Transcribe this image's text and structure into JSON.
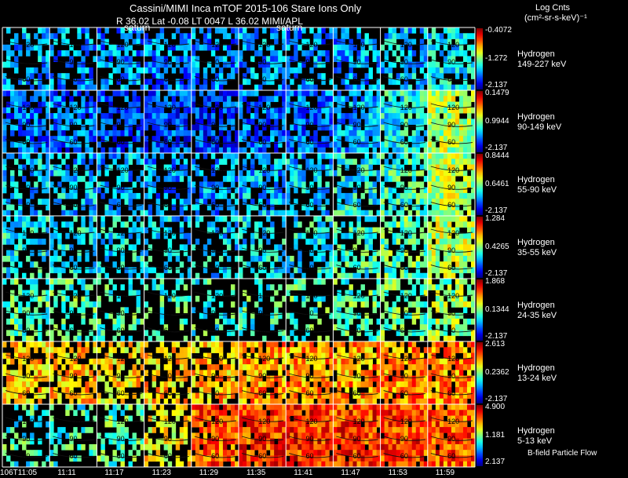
{
  "header": {
    "title": "Cassini/MIMI Inca mTOF  2015-106   Stare   Ions Only",
    "subtitle": "R         36.02  Lat -0.08  LT 0047  L          36.02  MIMI/APL",
    "units_line1": "Log Cnts",
    "units_line2": "(cm²-sr-s-keV)⁻¹",
    "footnote": "B-field Particle Flow",
    "panel_labels": [
      "saturn",
      "saturn"
    ]
  },
  "chart_data": {
    "type": "heatmap",
    "x_tick_labels": [
      "106T11:05",
      "11:11",
      "11:17",
      "11:23",
      "11:29",
      "11:35",
      "11:41",
      "11:47",
      "11:53",
      "11:59"
    ],
    "contour_labels": [
      "120",
      "90",
      "60"
    ],
    "rows": [
      {
        "species": "Hydrogen",
        "energy": "149-227 keV",
        "cb_max": "-0.4072",
        "cb_mid": "-1.272",
        "cb_min": "-2.137",
        "level": [
          0.3,
          0.28,
          0.27,
          0.25,
          0.26,
          0.28,
          0.27,
          0.28,
          0.32,
          0.36
        ],
        "fill": [
          0.5,
          0.5,
          0.55,
          0.6,
          0.6,
          0.55,
          0.55,
          0.55,
          0.6,
          0.65
        ]
      },
      {
        "species": "Hydrogen",
        "energy": "90-149 keV",
        "cb_max": "0.1479",
        "cb_mid": "0.9944",
        "cb_min": "-2.137",
        "level": [
          0.22,
          0.22,
          0.2,
          0.18,
          0.18,
          0.22,
          0.22,
          0.3,
          0.38,
          0.55
        ],
        "fill": [
          0.75,
          0.75,
          0.7,
          0.7,
          0.7,
          0.7,
          0.75,
          0.8,
          0.85,
          0.9
        ]
      },
      {
        "species": "Hydrogen",
        "energy": "55-90 keV",
        "cb_max": "0.8444",
        "cb_mid": "0.6461",
        "cb_min": "-2.137",
        "level": [
          0.32,
          0.32,
          0.3,
          0.28,
          0.28,
          0.3,
          0.32,
          0.38,
          0.42,
          0.55
        ],
        "fill": [
          0.55,
          0.55,
          0.55,
          0.5,
          0.55,
          0.55,
          0.6,
          0.65,
          0.7,
          0.9
        ]
      },
      {
        "species": "Hydrogen",
        "energy": "35-55 keV",
        "cb_max": "1.284",
        "cb_mid": "0.4265",
        "cb_min": "-2.137",
        "level": [
          0.38,
          0.38,
          0.36,
          0.34,
          0.34,
          0.35,
          0.38,
          0.42,
          0.46,
          0.55
        ],
        "fill": [
          0.5,
          0.5,
          0.45,
          0.4,
          0.45,
          0.5,
          0.55,
          0.6,
          0.7,
          0.85
        ]
      },
      {
        "species": "Hydrogen",
        "energy": "24-35 keV",
        "cb_max": "1.868",
        "cb_mid": "0.1344",
        "cb_min": "-2.137",
        "level": [
          0.45,
          0.45,
          0.44,
          0.42,
          0.42,
          0.42,
          0.43,
          0.45,
          0.48,
          0.52
        ],
        "fill": [
          0.55,
          0.5,
          0.4,
          0.3,
          0.3,
          0.3,
          0.35,
          0.45,
          0.55,
          0.7
        ]
      },
      {
        "species": "Hydrogen",
        "energy": "13-24 keV",
        "cb_max": "2.613",
        "cb_mid": "0.2362",
        "cb_min": "-2.137",
        "level": [
          0.68,
          0.68,
          0.66,
          0.68,
          0.7,
          0.72,
          0.72,
          0.72,
          0.74,
          0.74
        ],
        "fill": [
          0.75,
          0.7,
          0.6,
          0.55,
          0.7,
          0.8,
          0.85,
          0.85,
          0.85,
          0.85
        ]
      },
      {
        "species": "Hydrogen",
        "energy": "5-13 keV",
        "cb_max": "4.900",
        "cb_mid": "1.181",
        "cb_min": "2.137",
        "level": [
          0.42,
          0.42,
          0.45,
          0.62,
          0.8,
          0.83,
          0.84,
          0.83,
          0.82,
          0.8
        ],
        "fill": [
          0.35,
          0.35,
          0.45,
          0.6,
          0.9,
          0.95,
          0.95,
          0.95,
          0.95,
          0.95
        ]
      }
    ]
  }
}
